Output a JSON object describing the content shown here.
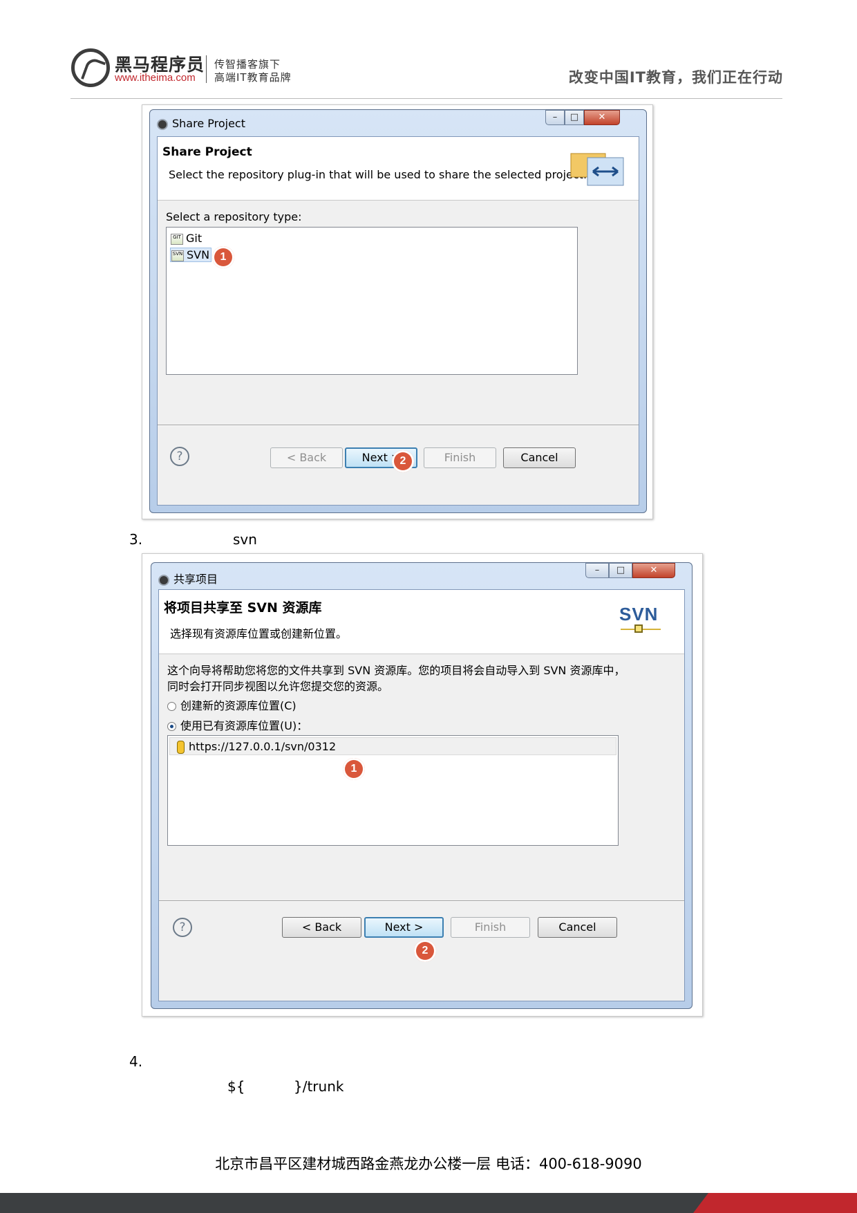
{
  "header": {
    "brand_cn": "黑马程序员",
    "brand_url": "www.itheima.com",
    "tagline_1": "传智播客旗下",
    "tagline_2": "高端IT教育品牌",
    "slogan": "改变中国IT教育，我们正在行动"
  },
  "dialog1": {
    "window_title": "Share Project",
    "heading": "Share Project",
    "description": "Select the repository plug-in that will be used to share the selected project.",
    "list_label": "Select a repository type:",
    "repository_types": [
      "Git",
      "SVN"
    ],
    "selected_type": "SVN",
    "buttons": {
      "back": "< Back",
      "next": "Next >",
      "finish": "Finish",
      "cancel": "Cancel"
    },
    "badges": [
      "1",
      "2"
    ]
  },
  "step3": {
    "number": "3.",
    "text": "svn"
  },
  "dialog2": {
    "window_title": "共享项目",
    "heading": "将项目共享至 SVN 资源库",
    "description": "选择现有资源库位置或创建新位置。",
    "svn_logo": "SVN",
    "info_line1": "这个向导将帮助您将您的文件共享到 SVN 资源库。您的项目将会自动导入到 SVN 资源库中，",
    "info_line2": "同时会打开同步视图以允许您提交您的资源。",
    "radio_create": "创建新的资源库位置(C)",
    "radio_use": "使用已有资源库位置(U)：",
    "repository_url": "https://127.0.0.1/svn/0312",
    "buttons": {
      "back": "< Back",
      "next": "Next >",
      "finish": "Finish",
      "cancel": "Cancel"
    },
    "badges": [
      "1",
      "2"
    ]
  },
  "step4": {
    "number": "4.",
    "path_prefix": "${",
    "path_suffix": "}/trunk"
  },
  "footer": {
    "address": "北京市昌平区建材城西路金燕龙办公楼一层   电话：400-618-9090"
  }
}
